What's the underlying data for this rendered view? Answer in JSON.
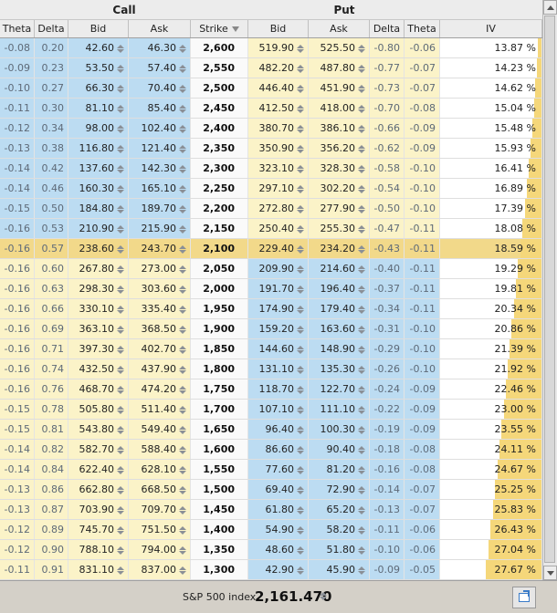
{
  "header": {
    "call_group": "Call",
    "put_group": "Put",
    "columns": [
      "Theta",
      "Delta",
      "Bid",
      "Ask",
      "Strike",
      "Bid",
      "Ask",
      "Delta",
      "Theta",
      "IV"
    ]
  },
  "rows": [
    {
      "c_theta": "-0.08",
      "c_delta": "0.20",
      "c_bid": "42.60",
      "c_ask": "46.30",
      "strike": "2,600",
      "p_bid": "519.90",
      "p_ask": "525.50",
      "p_delta": "-0.80",
      "p_theta": "-0.06",
      "iv": "13.87 %",
      "iv_value": 13.87
    },
    {
      "c_theta": "-0.09",
      "c_delta": "0.23",
      "c_bid": "53.50",
      "c_ask": "57.40",
      "strike": "2,550",
      "p_bid": "482.20",
      "p_ask": "487.80",
      "p_delta": "-0.77",
      "p_theta": "-0.07",
      "iv": "14.23 %",
      "iv_value": 14.23
    },
    {
      "c_theta": "-0.10",
      "c_delta": "0.27",
      "c_bid": "66.30",
      "c_ask": "70.40",
      "strike": "2,500",
      "p_bid": "446.40",
      "p_ask": "451.90",
      "p_delta": "-0.73",
      "p_theta": "-0.07",
      "iv": "14.62 %",
      "iv_value": 14.62
    },
    {
      "c_theta": "-0.11",
      "c_delta": "0.30",
      "c_bid": "81.10",
      "c_ask": "85.40",
      "strike": "2,450",
      "p_bid": "412.50",
      "p_ask": "418.00",
      "p_delta": "-0.70",
      "p_theta": "-0.08",
      "iv": "15.04 %",
      "iv_value": 15.04
    },
    {
      "c_theta": "-0.12",
      "c_delta": "0.34",
      "c_bid": "98.00",
      "c_ask": "102.40",
      "strike": "2,400",
      "p_bid": "380.70",
      "p_ask": "386.10",
      "p_delta": "-0.66",
      "p_theta": "-0.09",
      "iv": "15.48 %",
      "iv_value": 15.48
    },
    {
      "c_theta": "-0.13",
      "c_delta": "0.38",
      "c_bid": "116.80",
      "c_ask": "121.40",
      "strike": "2,350",
      "p_bid": "350.90",
      "p_ask": "356.20",
      "p_delta": "-0.62",
      "p_theta": "-0.09",
      "iv": "15.93 %",
      "iv_value": 15.93
    },
    {
      "c_theta": "-0.14",
      "c_delta": "0.42",
      "c_bid": "137.60",
      "c_ask": "142.30",
      "strike": "2,300",
      "p_bid": "323.10",
      "p_ask": "328.30",
      "p_delta": "-0.58",
      "p_theta": "-0.10",
      "iv": "16.41 %",
      "iv_value": 16.41
    },
    {
      "c_theta": "-0.14",
      "c_delta": "0.46",
      "c_bid": "160.30",
      "c_ask": "165.10",
      "strike": "2,250",
      "p_bid": "297.10",
      "p_ask": "302.20",
      "p_delta": "-0.54",
      "p_theta": "-0.10",
      "iv": "16.89 %",
      "iv_value": 16.89
    },
    {
      "c_theta": "-0.15",
      "c_delta": "0.50",
      "c_bid": "184.80",
      "c_ask": "189.70",
      "strike": "2,200",
      "p_bid": "272.80",
      "p_ask": "277.90",
      "p_delta": "-0.50",
      "p_theta": "-0.10",
      "iv": "17.39 %",
      "iv_value": 17.39
    },
    {
      "c_theta": "-0.16",
      "c_delta": "0.53",
      "c_bid": "210.90",
      "c_ask": "215.90",
      "strike": "2,150",
      "p_bid": "250.40",
      "p_ask": "255.30",
      "p_delta": "-0.47",
      "p_theta": "-0.11",
      "iv": "18.08 %",
      "iv_value": 18.08
    },
    {
      "c_theta": "-0.16",
      "c_delta": "0.57",
      "c_bid": "238.60",
      "c_ask": "243.70",
      "strike": "2,100",
      "p_bid": "229.40",
      "p_ask": "234.20",
      "p_delta": "-0.43",
      "p_theta": "-0.11",
      "iv": "18.59 %",
      "iv_value": 18.59,
      "atm": true
    },
    {
      "c_theta": "-0.16",
      "c_delta": "0.60",
      "c_bid": "267.80",
      "c_ask": "273.00",
      "strike": "2,050",
      "p_bid": "209.90",
      "p_ask": "214.60",
      "p_delta": "-0.40",
      "p_theta": "-0.11",
      "iv": "19.29 %",
      "iv_value": 19.29
    },
    {
      "c_theta": "-0.16",
      "c_delta": "0.63",
      "c_bid": "298.30",
      "c_ask": "303.60",
      "strike": "2,000",
      "p_bid": "191.70",
      "p_ask": "196.40",
      "p_delta": "-0.37",
      "p_theta": "-0.11",
      "iv": "19.81 %",
      "iv_value": 19.81
    },
    {
      "c_theta": "-0.16",
      "c_delta": "0.66",
      "c_bid": "330.10",
      "c_ask": "335.40",
      "strike": "1,950",
      "p_bid": "174.90",
      "p_ask": "179.40",
      "p_delta": "-0.34",
      "p_theta": "-0.11",
      "iv": "20.34 %",
      "iv_value": 20.34
    },
    {
      "c_theta": "-0.16",
      "c_delta": "0.69",
      "c_bid": "363.10",
      "c_ask": "368.50",
      "strike": "1,900",
      "p_bid": "159.20",
      "p_ask": "163.60",
      "p_delta": "-0.31",
      "p_theta": "-0.10",
      "iv": "20.86 %",
      "iv_value": 20.86
    },
    {
      "c_theta": "-0.16",
      "c_delta": "0.71",
      "c_bid": "397.30",
      "c_ask": "402.70",
      "strike": "1,850",
      "p_bid": "144.60",
      "p_ask": "148.90",
      "p_delta": "-0.29",
      "p_theta": "-0.10",
      "iv": "21.39 %",
      "iv_value": 21.39
    },
    {
      "c_theta": "-0.16",
      "c_delta": "0.74",
      "c_bid": "432.50",
      "c_ask": "437.90",
      "strike": "1,800",
      "p_bid": "131.10",
      "p_ask": "135.30",
      "p_delta": "-0.26",
      "p_theta": "-0.10",
      "iv": "21.92 %",
      "iv_value": 21.92
    },
    {
      "c_theta": "-0.16",
      "c_delta": "0.76",
      "c_bid": "468.70",
      "c_ask": "474.20",
      "strike": "1,750",
      "p_bid": "118.70",
      "p_ask": "122.70",
      "p_delta": "-0.24",
      "p_theta": "-0.09",
      "iv": "22.46 %",
      "iv_value": 22.46
    },
    {
      "c_theta": "-0.15",
      "c_delta": "0.78",
      "c_bid": "505.80",
      "c_ask": "511.40",
      "strike": "1,700",
      "p_bid": "107.10",
      "p_ask": "111.10",
      "p_delta": "-0.22",
      "p_theta": "-0.09",
      "iv": "23.00 %",
      "iv_value": 23.0
    },
    {
      "c_theta": "-0.15",
      "c_delta": "0.81",
      "c_bid": "543.80",
      "c_ask": "549.40",
      "strike": "1,650",
      "p_bid": "96.40",
      "p_ask": "100.30",
      "p_delta": "-0.19",
      "p_theta": "-0.09",
      "iv": "23.55 %",
      "iv_value": 23.55
    },
    {
      "c_theta": "-0.14",
      "c_delta": "0.82",
      "c_bid": "582.70",
      "c_ask": "588.40",
      "strike": "1,600",
      "p_bid": "86.60",
      "p_ask": "90.40",
      "p_delta": "-0.18",
      "p_theta": "-0.08",
      "iv": "24.11 %",
      "iv_value": 24.11
    },
    {
      "c_theta": "-0.14",
      "c_delta": "0.84",
      "c_bid": "622.40",
      "c_ask": "628.10",
      "strike": "1,550",
      "p_bid": "77.60",
      "p_ask": "81.20",
      "p_delta": "-0.16",
      "p_theta": "-0.08",
      "iv": "24.67 %",
      "iv_value": 24.67
    },
    {
      "c_theta": "-0.13",
      "c_delta": "0.86",
      "c_bid": "662.80",
      "c_ask": "668.50",
      "strike": "1,500",
      "p_bid": "69.40",
      "p_ask": "72.90",
      "p_delta": "-0.14",
      "p_theta": "-0.07",
      "iv": "25.25 %",
      "iv_value": 25.25
    },
    {
      "c_theta": "-0.13",
      "c_delta": "0.87",
      "c_bid": "703.90",
      "c_ask": "709.70",
      "strike": "1,450",
      "p_bid": "61.80",
      "p_ask": "65.20",
      "p_delta": "-0.13",
      "p_theta": "-0.07",
      "iv": "25.83 %",
      "iv_value": 25.83
    },
    {
      "c_theta": "-0.12",
      "c_delta": "0.89",
      "c_bid": "745.70",
      "c_ask": "751.50",
      "strike": "1,400",
      "p_bid": "54.90",
      "p_ask": "58.20",
      "p_delta": "-0.11",
      "p_theta": "-0.06",
      "iv": "26.43 %",
      "iv_value": 26.43
    },
    {
      "c_theta": "-0.12",
      "c_delta": "0.90",
      "c_bid": "788.10",
      "c_ask": "794.00",
      "strike": "1,350",
      "p_bid": "48.60",
      "p_ask": "51.80",
      "p_delta": "-0.10",
      "p_theta": "-0.06",
      "iv": "27.04 %",
      "iv_value": 27.04
    },
    {
      "c_theta": "-0.11",
      "c_delta": "0.91",
      "c_bid": "831.10",
      "c_ask": "837.00",
      "strike": "1,300",
      "p_bid": "42.90",
      "p_ask": "45.90",
      "p_delta": "-0.09",
      "p_theta": "-0.05",
      "iv": "27.67 %",
      "iv_value": 27.67
    }
  ],
  "iv_scale_max": 40,
  "footer": {
    "index_label": "S&P 500 index",
    "index_value": "2,161.470"
  },
  "colors": {
    "itm_call": "#bcdcf2",
    "otm": "#fbf3c8",
    "atm": "#f2d98a",
    "iv_bar": "#f5d77a"
  }
}
